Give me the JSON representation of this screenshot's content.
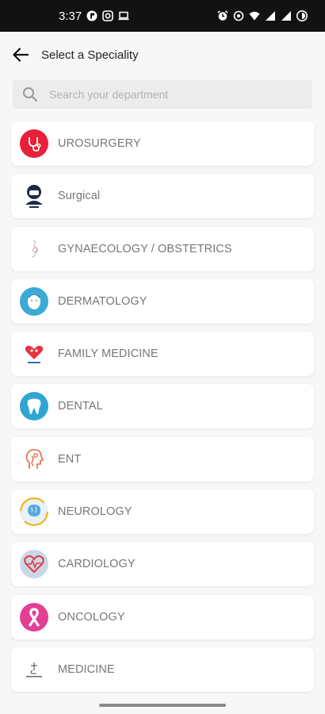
{
  "status_bar": {
    "time": "3:37"
  },
  "header": {
    "title": "Select a Speciality"
  },
  "search": {
    "placeholder": "Search your department"
  },
  "specialities": [
    {
      "label": "UROSURGERY",
      "icon": "stethoscope-icon",
      "color": "#e8203a"
    },
    {
      "label": "Surgical",
      "icon": "surgeon-icon",
      "color": "#1e2a48"
    },
    {
      "label": "GYNAECOLOGY / OBSTETRICS",
      "icon": "pregnancy-icon",
      "color": "#c9c9c9"
    },
    {
      "label": "DERMATOLOGY",
      "icon": "face-icon",
      "color": "#3da9d6"
    },
    {
      "label": "FAMILY MEDICINE",
      "icon": "family-heart-icon",
      "color": "#e8323e"
    },
    {
      "label": "DENTAL",
      "icon": "tooth-icon",
      "color": "#2fa6d2"
    },
    {
      "label": "ENT",
      "icon": "ent-head-icon",
      "color": "#e26a3a"
    },
    {
      "label": "NEUROLOGY",
      "icon": "brain-icon",
      "color": "#5aa8e0"
    },
    {
      "label": "CARDIOLOGY",
      "icon": "heartbeat-icon",
      "color": "#e03a45"
    },
    {
      "label": "ONCOLOGY",
      "icon": "ribbon-icon",
      "color": "#e33f95"
    },
    {
      "label": "MEDICINE",
      "icon": "medicine-icon",
      "color": "#444444"
    }
  ]
}
